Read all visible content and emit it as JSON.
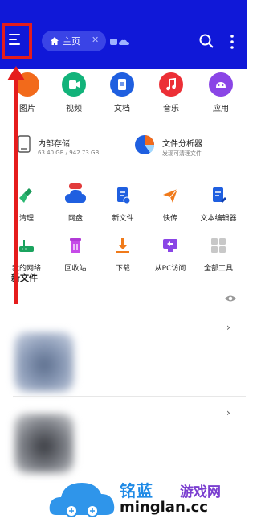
{
  "header": {
    "tab_label": "主页",
    "tab_close": "✕"
  },
  "categories": [
    {
      "label": "图片",
      "icon": "image-icon",
      "color": "#f26a1b"
    },
    {
      "label": "视频",
      "icon": "video-icon",
      "color": "#12b37a"
    },
    {
      "label": "文档",
      "icon": "document-icon",
      "color": "#1f5fe0"
    },
    {
      "label": "音乐",
      "icon": "music-icon",
      "color": "#ec2f36"
    },
    {
      "label": "应用",
      "icon": "app-icon",
      "color": "#8a45e6"
    }
  ],
  "storage": {
    "internal_title": "内部存储",
    "internal_usage": "63.40 GB / 942.73 GB",
    "analyzer_title": "文件分析器",
    "analyzer_sub": "发现可清理文件"
  },
  "tools_row1": [
    {
      "label": "清理",
      "icon": "broom-icon"
    },
    {
      "label": "网盘",
      "icon": "cloud-drive-icon"
    },
    {
      "label": "新文件",
      "icon": "new-file-icon"
    },
    {
      "label": "快传",
      "icon": "send-icon"
    },
    {
      "label": "文本编辑器",
      "icon": "text-editor-icon"
    }
  ],
  "tools_row2": [
    {
      "label": "我的网络",
      "icon": "network-icon"
    },
    {
      "label": "回收站",
      "icon": "recycle-bin-icon"
    },
    {
      "label": "下载",
      "icon": "download-icon"
    },
    {
      "label": "从PC访问",
      "icon": "pc-access-icon"
    },
    {
      "label": "全部工具",
      "icon": "all-tools-icon"
    }
  ],
  "recent": {
    "title": "新文件"
  },
  "watermark": {
    "brand": "铭蓝",
    "suffix": "游戏网",
    "domain": "minglan.cc"
  },
  "colors": {
    "header": "#1018d8",
    "annotation": "#e51c1c"
  }
}
